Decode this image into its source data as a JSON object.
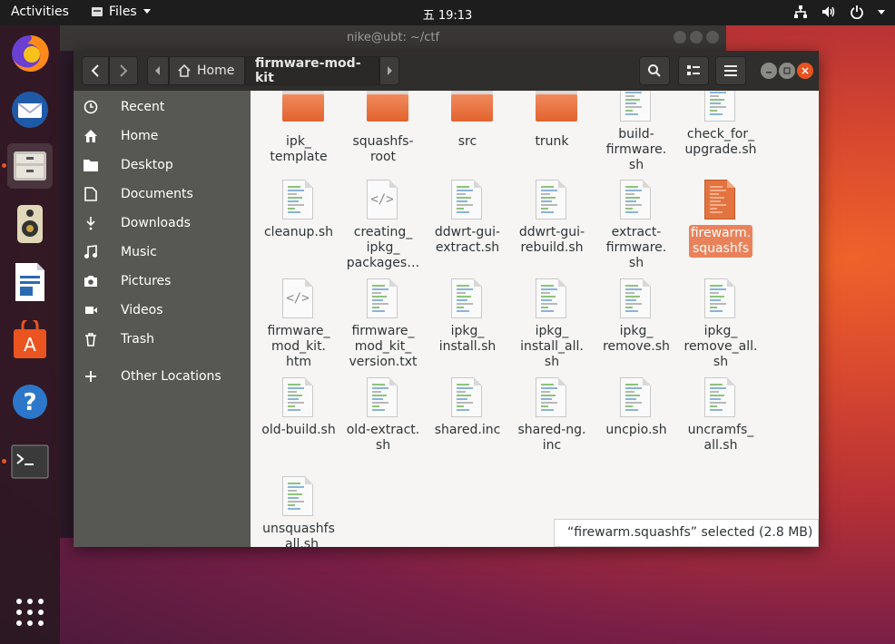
{
  "topbar": {
    "activities": "Activities",
    "app_menu": "Files",
    "clock": "五 19:13"
  },
  "terminal": {
    "title": "nike@ubt: ~/ctf"
  },
  "window": {
    "breadcrumb_home": "Home",
    "breadcrumb_current": "firmware-mod-kit"
  },
  "sidebar": {
    "items": [
      {
        "label": "Recent",
        "icon": "clock-icon"
      },
      {
        "label": "Home",
        "icon": "home-icon"
      },
      {
        "label": "Desktop",
        "icon": "folder-icon"
      },
      {
        "label": "Documents",
        "icon": "document-icon"
      },
      {
        "label": "Downloads",
        "icon": "download-icon"
      },
      {
        "label": "Music",
        "icon": "music-icon"
      },
      {
        "label": "Pictures",
        "icon": "camera-icon"
      },
      {
        "label": "Videos",
        "icon": "video-icon"
      },
      {
        "label": "Trash",
        "icon": "trash-icon"
      },
      {
        "label": "Other Locations",
        "icon": "plus-icon"
      }
    ]
  },
  "files": [
    {
      "name": "ipk_\ntemplate",
      "type": "folder"
    },
    {
      "name": "squashfs-\nroot",
      "type": "folder"
    },
    {
      "name": "src",
      "type": "folder"
    },
    {
      "name": "trunk",
      "type": "folder"
    },
    {
      "name": "build-\nfirmware.\nsh",
      "type": "script"
    },
    {
      "name": "check_for_\nupgrade.sh",
      "type": "script"
    },
    {
      "name": "cleanup.sh",
      "type": "script"
    },
    {
      "name": "creating_\nipkg_\npackages…",
      "type": "code"
    },
    {
      "name": "ddwrt-gui-\nextract.sh",
      "type": "script"
    },
    {
      "name": "ddwrt-gui-\nrebuild.sh",
      "type": "script"
    },
    {
      "name": "extract-\nfirmware.\nsh",
      "type": "script"
    },
    {
      "name": "firewarm.\nsquashfs",
      "type": "binary",
      "selected": true
    },
    {
      "name": "firmware_\nmod_kit.\nhtm",
      "type": "code"
    },
    {
      "name": "firmware_\nmod_kit_\nversion.txt",
      "type": "text"
    },
    {
      "name": "ipkg_\ninstall.sh",
      "type": "script"
    },
    {
      "name": "ipkg_\ninstall_all.\nsh",
      "type": "script"
    },
    {
      "name": "ipkg_\nremove.sh",
      "type": "script"
    },
    {
      "name": "ipkg_\nremove_all.\nsh",
      "type": "script"
    },
    {
      "name": "old-build.sh",
      "type": "script"
    },
    {
      "name": "old-extract.\nsh",
      "type": "script"
    },
    {
      "name": "shared.inc",
      "type": "text"
    },
    {
      "name": "shared-ng.\ninc",
      "type": "text"
    },
    {
      "name": "uncpio.sh",
      "type": "script"
    },
    {
      "name": "uncramfs_\nall.sh",
      "type": "script"
    },
    {
      "name": "unsquashfs\n_all.sh",
      "type": "script"
    }
  ],
  "status": {
    "text": "“firewarm.squashfs” selected  (2.8 MB)"
  },
  "colors": {
    "accent": "#e95420",
    "sidebar": "#575753",
    "header": "#2f2e2c"
  }
}
